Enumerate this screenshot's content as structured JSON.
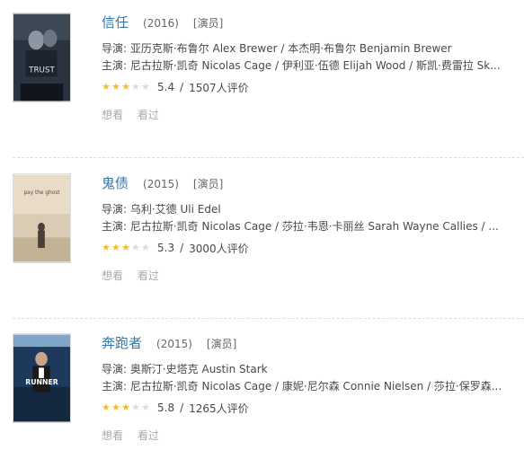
{
  "movies": [
    {
      "title": "信任",
      "year": "(2016)",
      "role": "[演员]",
      "director": "导演: 亚历克斯·布鲁尔 Alex Brewer / 本杰明·布鲁尔 Benjamin Brewer",
      "cast": "主演: 尼古拉斯·凯奇 Nicolas Cage / 伊利亚·伍德 Elijah Wood / 斯凯·费雷拉 Sk...",
      "stars_filled": 3,
      "score": "5.4",
      "votes": "1507人评价",
      "poster_text": "TRUST",
      "poster_colors": {
        "bg": "#2a3340",
        "figure": "#8c97a3",
        "light": "#b9c2cb"
      }
    },
    {
      "title": "鬼债",
      "year": "(2015)",
      "role": "[演员]",
      "director": "导演: 乌利·艾德 Uli Edel",
      "cast": "主演: 尼古拉斯·凯奇 Nicolas Cage / 莎拉·韦恩·卡丽丝 Sarah Wayne Callies / ...",
      "stars_filled": 3,
      "score": "5.3",
      "votes": "3000人评价",
      "poster_text": "pay the ghost",
      "poster_colors": {
        "bg": "#d9cbb4",
        "figure": "#4a4037",
        "light": "#efe6d6"
      }
    },
    {
      "title": "奔跑者",
      "year": "(2015)",
      "role": "[演员]",
      "director": "导演: 奥斯汀·史塔克 Austin Stark",
      "cast": "主演: 尼古拉斯·凯奇 Nicolas Cage / 康妮·尼尔森 Connie Nielsen / 莎拉·保罗森...",
      "stars_filled": 3,
      "score": "5.8",
      "votes": "1265人评价",
      "poster_text": "RUNNER",
      "poster_colors": {
        "bg": "#1d3a5c",
        "figure": "#1a1a1a",
        "light": "#7fa6c9"
      }
    }
  ],
  "actions": {
    "want": "想看",
    "seen": "看过"
  },
  "separator": "/"
}
